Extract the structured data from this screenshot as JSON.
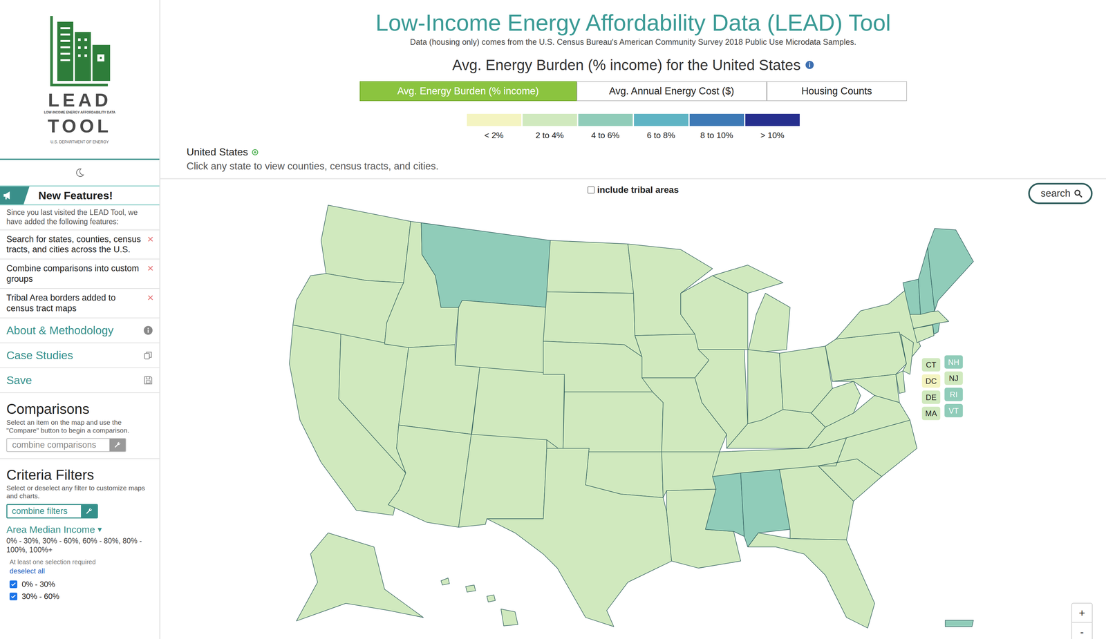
{
  "sidebar": {
    "logo": {
      "title": "LEAD",
      "subtitle": "LOW-INCOME ENERGY AFFORDABILITY DATA",
      "title2": "TOOL",
      "agency": "U.S. DEPARTMENT OF ENERGY"
    },
    "new_features": {
      "title": "New Features!",
      "description": "Since you last visited the LEAD Tool, we have added the following features:",
      "items": [
        {
          "text": "Search for states, counties, census tracts, and cities across the U.S.",
          "close": "×"
        },
        {
          "text": "Combine comparisons into custom groups",
          "close": "×"
        },
        {
          "text": "Tribal Area borders added to census tract maps",
          "close": "×"
        }
      ]
    },
    "links": [
      {
        "label": "About & Methodology",
        "icon": "info"
      },
      {
        "label": "Case Studies",
        "icon": "copy"
      },
      {
        "label": "Save",
        "icon": "save"
      }
    ],
    "comparisons": {
      "title": "Comparisons",
      "description": "Select an item on the map and use the \"Compare\" button to begin a comparison.",
      "placeholder": "combine comparisons"
    },
    "criteria": {
      "title": "Criteria Filters",
      "description": "Select or deselect any filter to customize maps and charts.",
      "button": "combine filters",
      "filter": {
        "label": "Area Median Income",
        "caret": "▾",
        "summary": "0% - 30%, 30% - 60%, 60% - 80%, 80% - 100%, 100%+",
        "note": "At least one selection required",
        "deselect": "deselect all",
        "options": [
          {
            "label": "0% - 30%",
            "checked": true
          },
          {
            "label": "30% - 60%",
            "checked": true
          }
        ]
      }
    }
  },
  "header": {
    "title": "Low-Income Energy Affordability Data (LEAD) Tool",
    "subtitle": "Data (housing only) comes from the U.S. Census Bureau's American Community Survey 2018 Public Use Microdata Samples.",
    "heading": "Avg. Energy Burden (% income) for the United States"
  },
  "tabs": [
    {
      "label": "Avg. Energy Burden (% income)",
      "selected": true
    },
    {
      "label": "Avg. Annual Energy Cost ($)",
      "selected": false
    },
    {
      "label": "Housing Counts",
      "selected": false
    }
  ],
  "legend": [
    {
      "label": "< 2%",
      "color": "#f4f4c1"
    },
    {
      "label": "2 to 4%",
      "color": "#d0e9be"
    },
    {
      "label": "4 to 6%",
      "color": "#90ccb9"
    },
    {
      "label": "6 to 8%",
      "color": "#5fb4c4"
    },
    {
      "label": "8 to 10%",
      "color": "#3d79b6"
    },
    {
      "label": "> 10%",
      "color": "#262f8e"
    }
  ],
  "breadcrumb": {
    "label": "United States",
    "hint": "Click any state to view counties, census tracts, and cities."
  },
  "map": {
    "tribal": {
      "label": "include tribal areas",
      "checked": false
    },
    "search": "search",
    "zoom": [
      "+",
      "-"
    ],
    "states": [
      {
        "color": "#d0e9be"
      },
      {
        "color": "#d0e9be"
      },
      {
        "color": "#d0e9be"
      },
      {
        "color": "#d0e9be"
      },
      {
        "color": "#d0e9be"
      },
      {
        "color": "#90ccb9"
      },
      {
        "color": "#d0e9be"
      },
      {
        "color": "#d0e9be"
      },
      {
        "color": "#d0e9be"
      },
      {
        "color": "#d0e9be"
      },
      {
        "color": "#d0e9be"
      },
      {
        "color": "#d0e9be"
      },
      {
        "color": "#d0e9be"
      },
      {
        "color": "#d0e9be"
      },
      {
        "color": "#d0e9be"
      },
      {
        "color": "#d0e9be"
      },
      {
        "color": "#d0e9be"
      },
      {
        "color": "#d0e9be"
      },
      {
        "color": "#d0e9be"
      },
      {
        "color": "#d0e9be"
      },
      {
        "color": "#d0e9be"
      },
      {
        "color": "#d0e9be"
      },
      {
        "color": "#d0e9be"
      },
      {
        "color": "#d0e9be"
      },
      {
        "color": "#d0e9be"
      },
      {
        "color": "#d0e9be"
      },
      {
        "color": "#d0e9be"
      },
      {
        "color": "#d0e9be"
      },
      {
        "color": "#d0e9be"
      },
      {
        "color": "#90ccb9"
      },
      {
        "color": "#90ccb9"
      },
      {
        "color": "#d0e9be"
      },
      {
        "color": "#d0e9be"
      },
      {
        "color": "#d0e9be"
      },
      {
        "color": "#d0e9be"
      },
      {
        "color": "#d0e9be"
      },
      {
        "color": "#d0e9be"
      },
      {
        "color": "#d0e9be"
      },
      {
        "color": "#d0e9be"
      },
      {
        "color": "#d0e9be"
      },
      {
        "color": "#d0e9be"
      },
      {
        "color": "#d0e9be"
      },
      {
        "color": "#d0e9be"
      },
      {
        "color": "#90ccb9"
      },
      {
        "color": "#d0e9be"
      },
      {
        "color": "#90ccb9"
      },
      {
        "color": "#90ccb9"
      },
      {
        "color": "#90ccb9"
      },
      {
        "color": "#d0e9be"
      },
      {
        "color": "#d0e9be"
      },
      {
        "color": "#90ccb9"
      }
    ],
    "small_states": [
      {
        "label": "CT",
        "color": "#d0e9be"
      },
      {
        "label": "NH",
        "color": "#90ccb9"
      },
      {
        "label": "DC",
        "color": "#f4f4c1"
      },
      {
        "label": "NJ",
        "color": "#d0e9be"
      },
      {
        "label": "DE",
        "color": "#d0e9be"
      },
      {
        "label": "RI",
        "color": "#90ccb9"
      },
      {
        "label": "MA",
        "color": "#d0e9be"
      },
      {
        "label": "VT",
        "color": "#90ccb9"
      }
    ]
  }
}
